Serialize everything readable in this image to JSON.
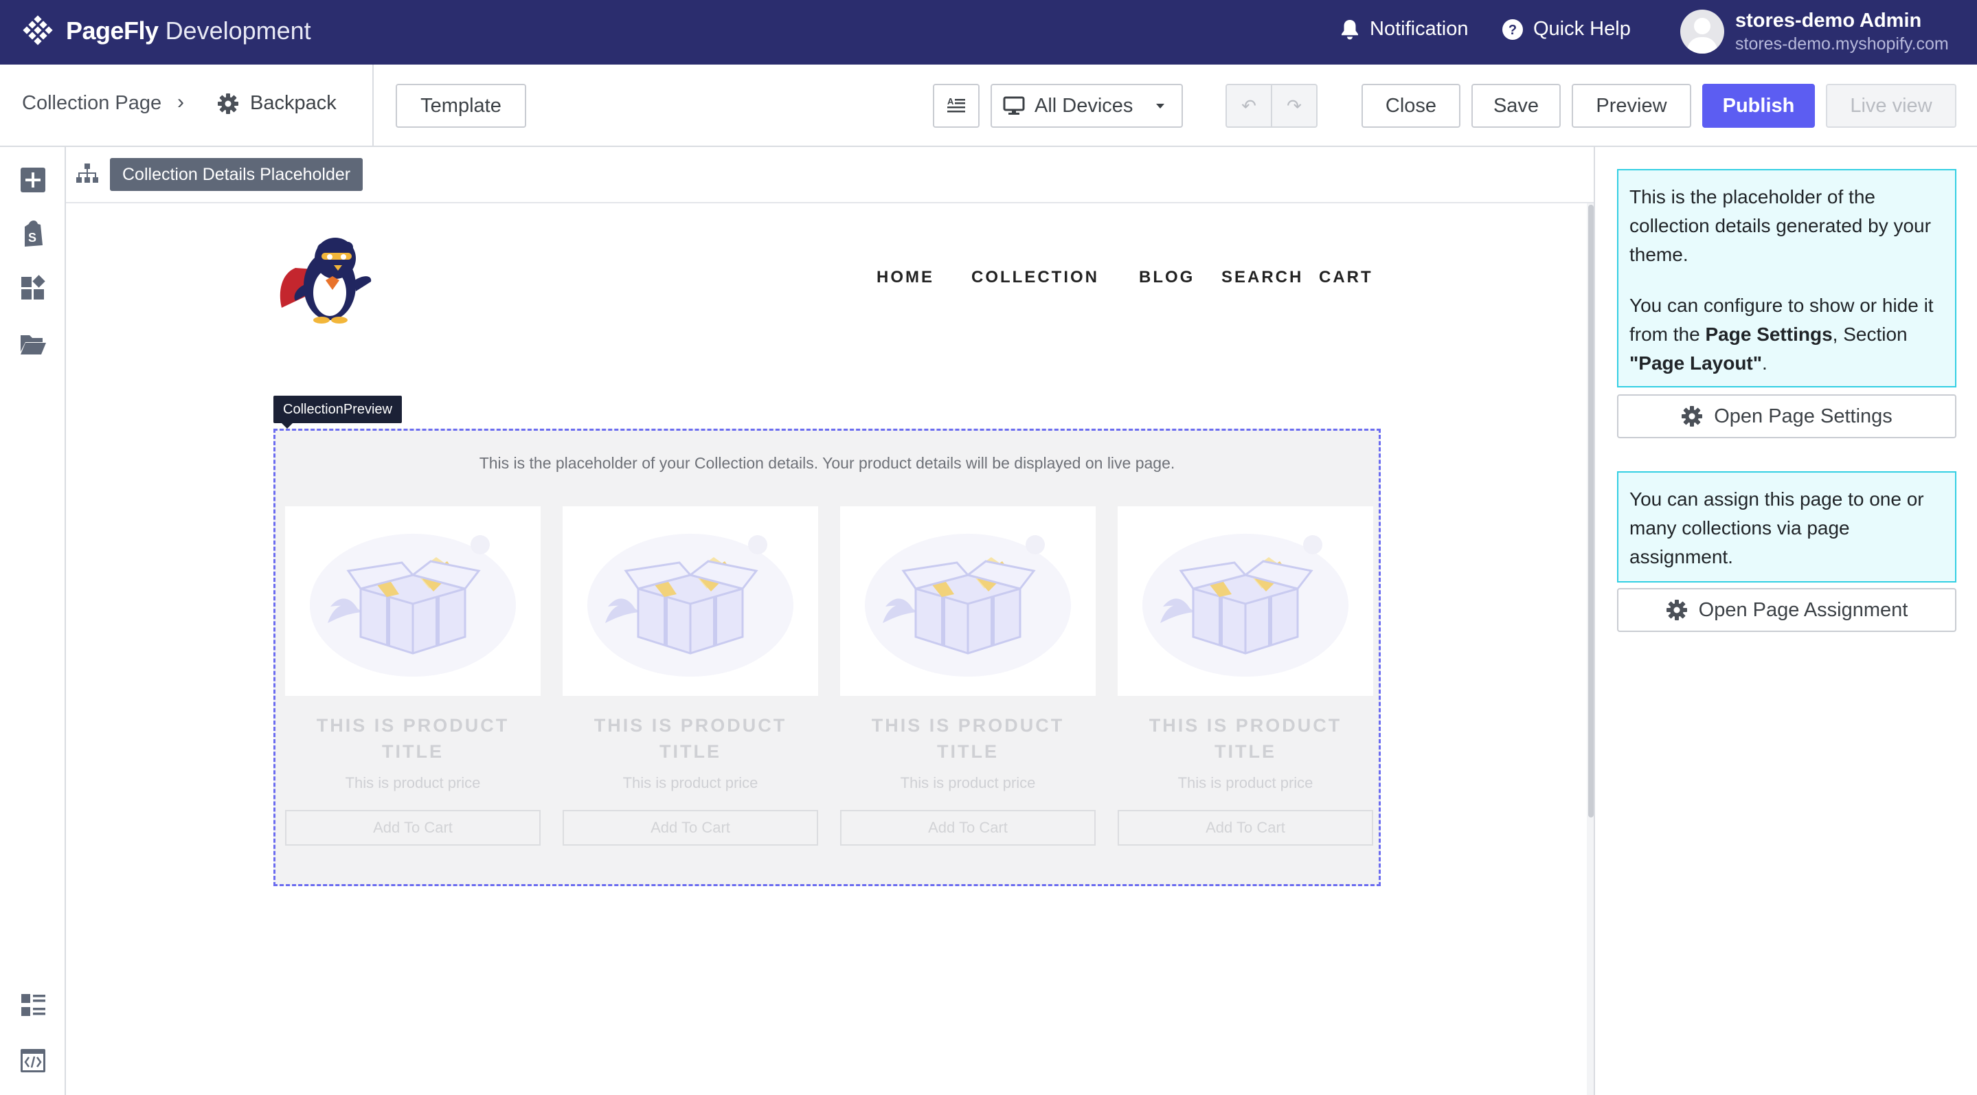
{
  "topbar": {
    "brand": "PageFly",
    "brand_suffix": "Development",
    "notification": "Notification",
    "quick_help": "Quick Help",
    "user_name": "stores-demo Admin",
    "user_store": "stores-demo.myshopify.com"
  },
  "toolbar": {
    "breadcrumb_page": "Collection Page",
    "breadcrumb_separator": "›",
    "breadcrumb_item": "Backpack",
    "template": "Template",
    "devices": "All Devices",
    "undo": "↶",
    "redo": "↷",
    "close": "Close",
    "save": "Save",
    "preview": "Preview",
    "publish": "Publish",
    "live_view": "Live view"
  },
  "canvas": {
    "selected_element": "Collection Details Placeholder",
    "nav": [
      "HOME",
      "COLLECTION",
      "BLOG",
      "SEARCH",
      "CART"
    ],
    "preview_tag": "CollectionPreview",
    "placeholder_note": "This is the placeholder of your Collection details. Your product details will be displayed on live page.",
    "products": [
      {
        "title": "THIS IS PRODUCT TITLE",
        "price": "This is product price",
        "button": "Add To Cart"
      },
      {
        "title": "THIS IS PRODUCT TITLE",
        "price": "This is product price",
        "button": "Add To Cart"
      },
      {
        "title": "THIS IS PRODUCT TITLE",
        "price": "This is product price",
        "button": "Add To Cart"
      },
      {
        "title": "THIS IS PRODUCT TITLE",
        "price": "This is product price",
        "button": "Add To Cart"
      }
    ]
  },
  "sidebar": {
    "info1_p1": "This is the placeholder of the collection details generated by your theme.",
    "info1_p2_a": "You can configure to show or hide it from the ",
    "info1_p2_b": "Page Settings",
    "info1_p2_c": ", Section ",
    "info1_p2_d": "\"Page Layout\"",
    "info1_p2_e": ".",
    "open_page_settings": "Open Page Settings",
    "info2": "You can assign this page to one or many collections via page assignment.",
    "open_page_assignment": "Open Page Assignment"
  },
  "colors": {
    "topbar": "#2b2d6e",
    "publish": "#5c5df2",
    "info_border": "#33cfe3",
    "info_bg": "#e8fbfd"
  }
}
